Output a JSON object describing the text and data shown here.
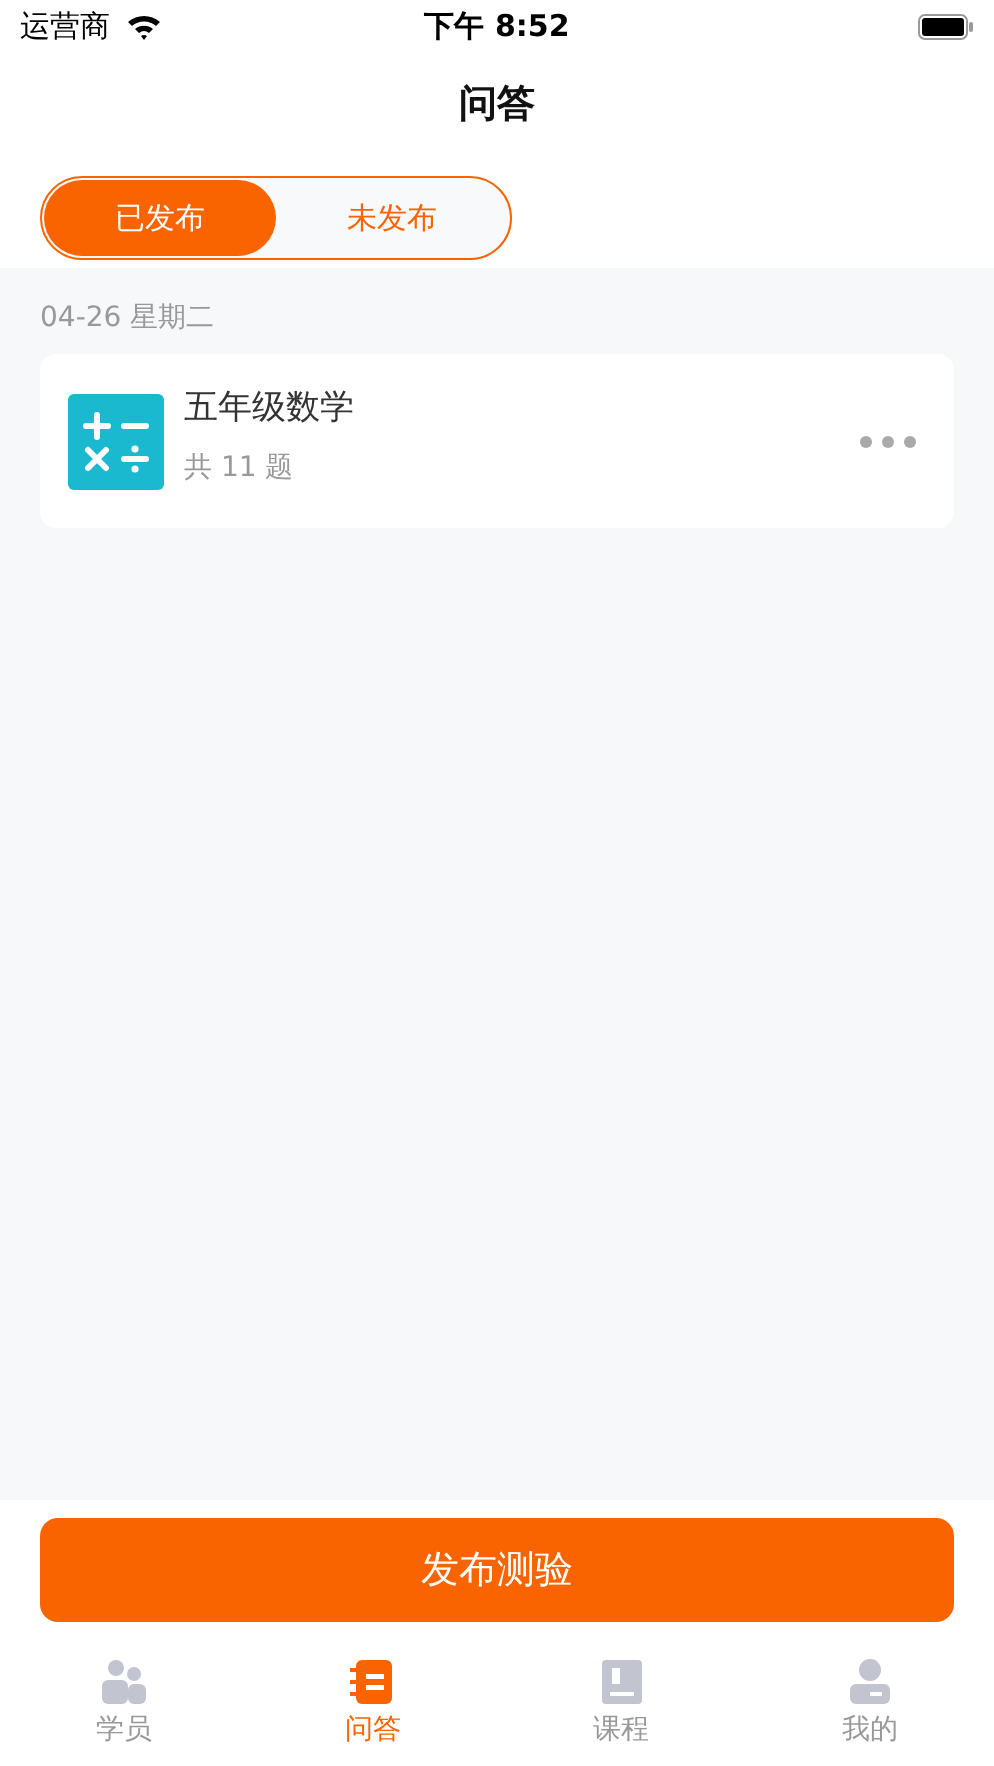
{
  "status_bar": {
    "carrier": "运营商",
    "time": "下午 8:52"
  },
  "title": "问答",
  "segments": [
    {
      "label": "已发布",
      "selected": true
    },
    {
      "label": "未发布",
      "selected": false
    }
  ],
  "groups": [
    {
      "date": "04-26 星期二",
      "items": [
        {
          "title": "五年级数学",
          "subtitle": "共 11 题"
        }
      ]
    }
  ],
  "primary_button": "发布测验",
  "tabbar": [
    {
      "kind": "students",
      "label": "学员",
      "selected": false
    },
    {
      "kind": "qa",
      "label": "问答",
      "selected": true
    },
    {
      "kind": "course",
      "label": "课程",
      "selected": false
    },
    {
      "kind": "me",
      "label": "我的",
      "selected": false
    }
  ]
}
